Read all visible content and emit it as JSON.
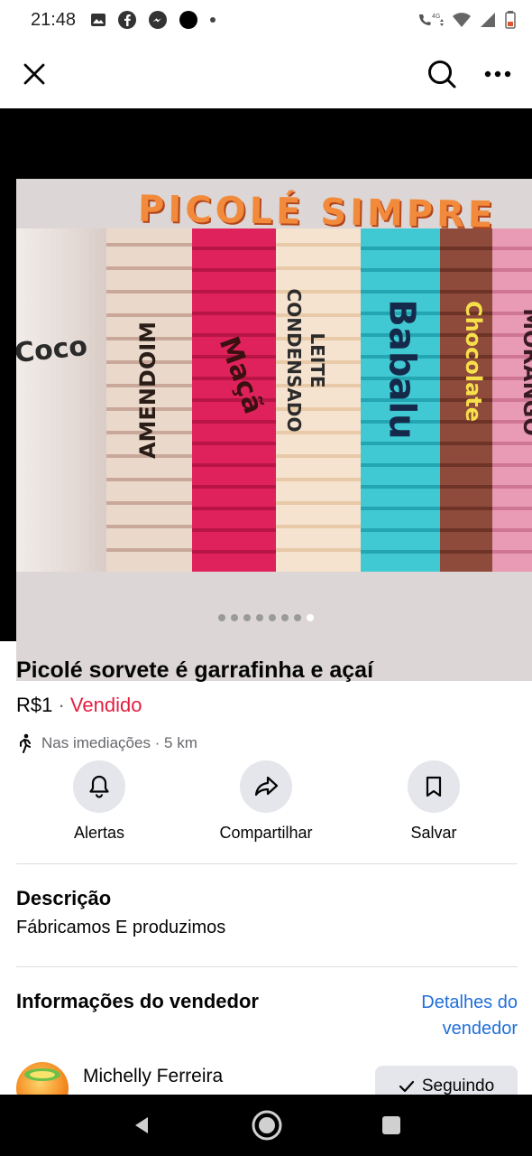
{
  "status_bar": {
    "time": "21:48",
    "network": "4G"
  },
  "top_bar": {
    "close_icon": "close-icon",
    "search_icon": "search-icon",
    "more_icon": "more-icon"
  },
  "listing_image": {
    "brand_text": "PICOLÉ SIMPRE",
    "flavors": [
      "Coco",
      "AMENDOIM",
      "Maçã",
      "LEITE CONDENSADO",
      "Babalu",
      "Chocolate",
      "MORANGO"
    ]
  },
  "carousel": {
    "total": 8,
    "active_index": 8
  },
  "listing": {
    "title": "Picolé sorvete é garrafinha  e açaí",
    "price": "R$1",
    "separator": " · ",
    "status": "Vendido",
    "location": "Nas imediações · 5 km"
  },
  "actions": {
    "alerts_label": "Alertas",
    "share_label": "Compartilhar",
    "save_label": "Salvar"
  },
  "description": {
    "heading": "Descrição",
    "text": "Fábricamos E produzimos"
  },
  "seller": {
    "heading": "Informações do vendedor",
    "details_link": "Detalhes do vendedor",
    "name": "Michelly Ferreira",
    "follow_label": "Seguindo"
  },
  "colors": {
    "sold": "#e41e3f",
    "link": "#216fdb",
    "button_bg": "#e4e6eb"
  }
}
